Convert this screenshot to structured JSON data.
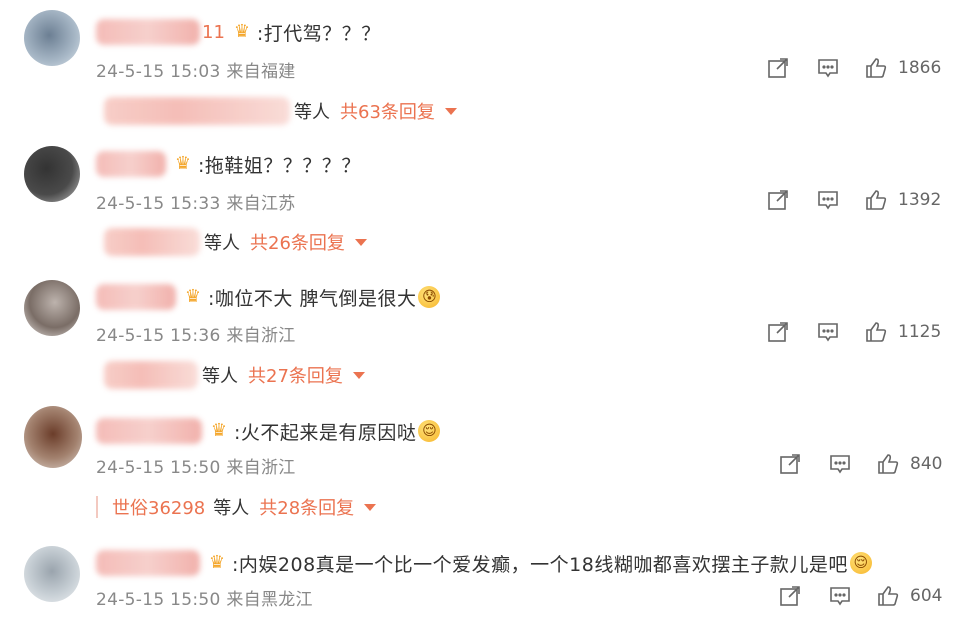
{
  "comments": [
    {
      "username_suffix": "11",
      "text": ":打代驾？？？",
      "emoji": "",
      "meta": "24-5-15 15:03 来自福建",
      "likes": "1866",
      "replies": {
        "users": "",
        "deng": "等人",
        "total": "共63条回复"
      }
    },
    {
      "username_suffix": "",
      "text": ":拖鞋姐？？？？？",
      "emoji": "",
      "meta": "24-5-15 15:33 来自江苏",
      "likes": "1392",
      "replies": {
        "users": "",
        "deng": "等人",
        "total": "共26条回复"
      }
    },
    {
      "username_suffix": "",
      "text": ":咖位不大 脾气倒是很大",
      "emoji": "😰",
      "meta": "24-5-15 15:36 来自浙江",
      "likes": "1125",
      "replies": {
        "users": "",
        "deng": "等人",
        "total": "共27条回复"
      }
    },
    {
      "username_suffix": "",
      "text": ":火不起来是有原因哒",
      "emoji": "😌",
      "meta": "24-5-15 15:50 来自浙江",
      "likes": "840",
      "replies": {
        "users": "世俗36298",
        "deng": "等人",
        "total": "共28条回复"
      }
    },
    {
      "username_suffix": "",
      "text": ":内娱208真是一个比一个爱发癫，一个18线糊咖都喜欢摆主子款儿是吧",
      "emoji": "😌",
      "meta": "24-5-15 15:50 来自黑龙江",
      "likes": "604",
      "replies": null
    }
  ],
  "icons": {
    "share": "share-icon",
    "comment": "comment-icon",
    "like": "like-icon",
    "crown": "crown-icon",
    "caret": "caret-down-icon"
  },
  "colors": {
    "accent": "#eb7350",
    "meta_text": "#888888",
    "body_text": "#333333"
  }
}
